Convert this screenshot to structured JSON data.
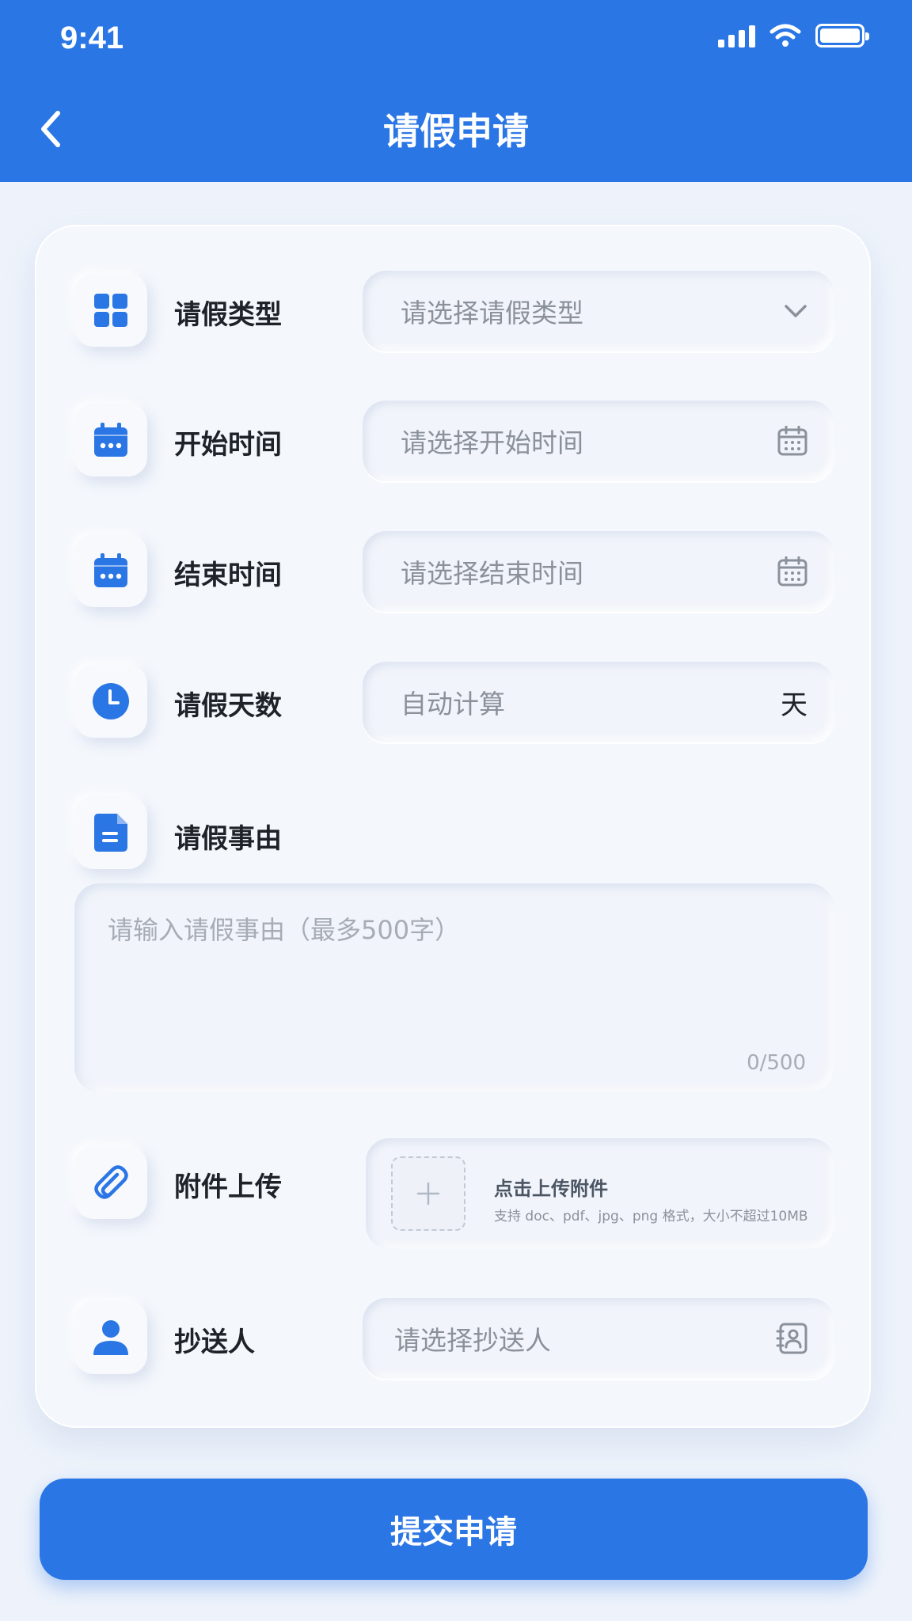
{
  "status_bar": {
    "time": "9:41"
  },
  "header": {
    "title": "请假申请"
  },
  "colors": {
    "primary": "#2b76e5",
    "background": "#eef3fb",
    "placeholder": "#8b919a"
  },
  "form": {
    "leave_type": {
      "label": "请假类型",
      "placeholder": "请选择请假类型",
      "icon": "grid-icon",
      "suffix_icon": "chevron-down-icon"
    },
    "start_time": {
      "label": "开始时间",
      "placeholder": "请选择开始时间",
      "icon": "calendar-icon",
      "suffix_icon": "calendar-icon"
    },
    "end_time": {
      "label": "结束时间",
      "placeholder": "请选择结束时间",
      "icon": "calendar-icon",
      "suffix_icon": "calendar-icon"
    },
    "days": {
      "label": "请假天数",
      "placeholder": "自动计算",
      "unit": "天",
      "icon": "clock-icon"
    },
    "reason": {
      "label": "请假事由",
      "placeholder": "请输入请假事由（最多500字）",
      "counter": "0/500",
      "icon": "document-icon"
    },
    "attachment": {
      "label": "附件上传",
      "title": "点击上传附件",
      "hint": "支持 doc、pdf、jpg、png 格式，大小不超过10MB",
      "icon": "paperclip-icon"
    },
    "cc": {
      "label": "抄送人",
      "placeholder": "请选择抄送人",
      "icon": "person-icon",
      "suffix_icon": "contact-book-icon"
    }
  },
  "submit_label": "提交申请"
}
